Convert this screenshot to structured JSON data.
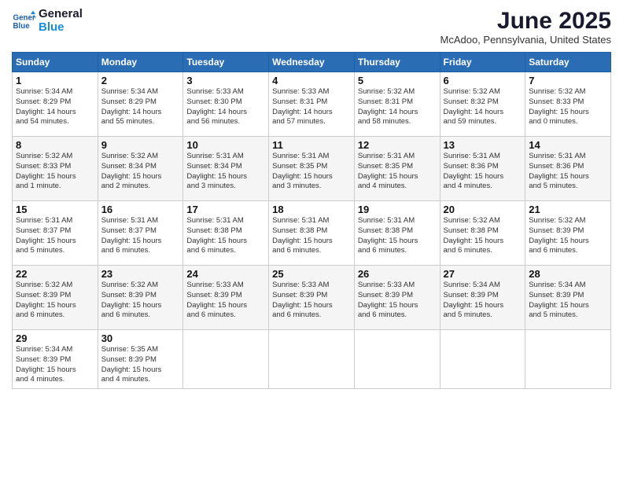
{
  "header": {
    "logo_line1": "General",
    "logo_line2": "Blue",
    "month_title": "June 2025",
    "location": "McAdoo, Pennsylvania, United States"
  },
  "weekdays": [
    "Sunday",
    "Monday",
    "Tuesday",
    "Wednesday",
    "Thursday",
    "Friday",
    "Saturday"
  ],
  "weeks": [
    [
      {
        "day": "1",
        "info": "Sunrise: 5:34 AM\nSunset: 8:29 PM\nDaylight: 14 hours\nand 54 minutes."
      },
      {
        "day": "2",
        "info": "Sunrise: 5:34 AM\nSunset: 8:29 PM\nDaylight: 14 hours\nand 55 minutes."
      },
      {
        "day": "3",
        "info": "Sunrise: 5:33 AM\nSunset: 8:30 PM\nDaylight: 14 hours\nand 56 minutes."
      },
      {
        "day": "4",
        "info": "Sunrise: 5:33 AM\nSunset: 8:31 PM\nDaylight: 14 hours\nand 57 minutes."
      },
      {
        "day": "5",
        "info": "Sunrise: 5:32 AM\nSunset: 8:31 PM\nDaylight: 14 hours\nand 58 minutes."
      },
      {
        "day": "6",
        "info": "Sunrise: 5:32 AM\nSunset: 8:32 PM\nDaylight: 14 hours\nand 59 minutes."
      },
      {
        "day": "7",
        "info": "Sunrise: 5:32 AM\nSunset: 8:33 PM\nDaylight: 15 hours\nand 0 minutes."
      }
    ],
    [
      {
        "day": "8",
        "info": "Sunrise: 5:32 AM\nSunset: 8:33 PM\nDaylight: 15 hours\nand 1 minute."
      },
      {
        "day": "9",
        "info": "Sunrise: 5:32 AM\nSunset: 8:34 PM\nDaylight: 15 hours\nand 2 minutes."
      },
      {
        "day": "10",
        "info": "Sunrise: 5:31 AM\nSunset: 8:34 PM\nDaylight: 15 hours\nand 3 minutes."
      },
      {
        "day": "11",
        "info": "Sunrise: 5:31 AM\nSunset: 8:35 PM\nDaylight: 15 hours\nand 3 minutes."
      },
      {
        "day": "12",
        "info": "Sunrise: 5:31 AM\nSunset: 8:35 PM\nDaylight: 15 hours\nand 4 minutes."
      },
      {
        "day": "13",
        "info": "Sunrise: 5:31 AM\nSunset: 8:36 PM\nDaylight: 15 hours\nand 4 minutes."
      },
      {
        "day": "14",
        "info": "Sunrise: 5:31 AM\nSunset: 8:36 PM\nDaylight: 15 hours\nand 5 minutes."
      }
    ],
    [
      {
        "day": "15",
        "info": "Sunrise: 5:31 AM\nSunset: 8:37 PM\nDaylight: 15 hours\nand 5 minutes."
      },
      {
        "day": "16",
        "info": "Sunrise: 5:31 AM\nSunset: 8:37 PM\nDaylight: 15 hours\nand 6 minutes."
      },
      {
        "day": "17",
        "info": "Sunrise: 5:31 AM\nSunset: 8:38 PM\nDaylight: 15 hours\nand 6 minutes."
      },
      {
        "day": "18",
        "info": "Sunrise: 5:31 AM\nSunset: 8:38 PM\nDaylight: 15 hours\nand 6 minutes."
      },
      {
        "day": "19",
        "info": "Sunrise: 5:31 AM\nSunset: 8:38 PM\nDaylight: 15 hours\nand 6 minutes."
      },
      {
        "day": "20",
        "info": "Sunrise: 5:32 AM\nSunset: 8:38 PM\nDaylight: 15 hours\nand 6 minutes."
      },
      {
        "day": "21",
        "info": "Sunrise: 5:32 AM\nSunset: 8:39 PM\nDaylight: 15 hours\nand 6 minutes."
      }
    ],
    [
      {
        "day": "22",
        "info": "Sunrise: 5:32 AM\nSunset: 8:39 PM\nDaylight: 15 hours\nand 6 minutes."
      },
      {
        "day": "23",
        "info": "Sunrise: 5:32 AM\nSunset: 8:39 PM\nDaylight: 15 hours\nand 6 minutes."
      },
      {
        "day": "24",
        "info": "Sunrise: 5:33 AM\nSunset: 8:39 PM\nDaylight: 15 hours\nand 6 minutes."
      },
      {
        "day": "25",
        "info": "Sunrise: 5:33 AM\nSunset: 8:39 PM\nDaylight: 15 hours\nand 6 minutes."
      },
      {
        "day": "26",
        "info": "Sunrise: 5:33 AM\nSunset: 8:39 PM\nDaylight: 15 hours\nand 6 minutes."
      },
      {
        "day": "27",
        "info": "Sunrise: 5:34 AM\nSunset: 8:39 PM\nDaylight: 15 hours\nand 5 minutes."
      },
      {
        "day": "28",
        "info": "Sunrise: 5:34 AM\nSunset: 8:39 PM\nDaylight: 15 hours\nand 5 minutes."
      }
    ],
    [
      {
        "day": "29",
        "info": "Sunrise: 5:34 AM\nSunset: 8:39 PM\nDaylight: 15 hours\nand 4 minutes."
      },
      {
        "day": "30",
        "info": "Sunrise: 5:35 AM\nSunset: 8:39 PM\nDaylight: 15 hours\nand 4 minutes."
      },
      null,
      null,
      null,
      null,
      null
    ]
  ]
}
